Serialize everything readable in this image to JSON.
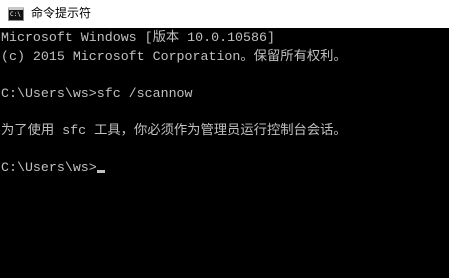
{
  "window": {
    "title": "命令提示符",
    "icon": "cmd-icon",
    "icon_label": "C:\\"
  },
  "console": {
    "lines": [
      "Microsoft Windows [版本 10.0.10586]",
      "(c) 2015 Microsoft Corporation。保留所有权利。",
      "",
      "C:\\Users\\ws>sfc /scannow",
      "",
      "为了使用 sfc 工具，你必须作为管理员运行控制台会话。",
      ""
    ],
    "prompt": "C:\\Users\\ws>"
  },
  "colors": {
    "title_bar_bg": "#ffffff",
    "title_text": "#000000",
    "console_bg": "#000000",
    "console_text": "#c0c0c0"
  }
}
